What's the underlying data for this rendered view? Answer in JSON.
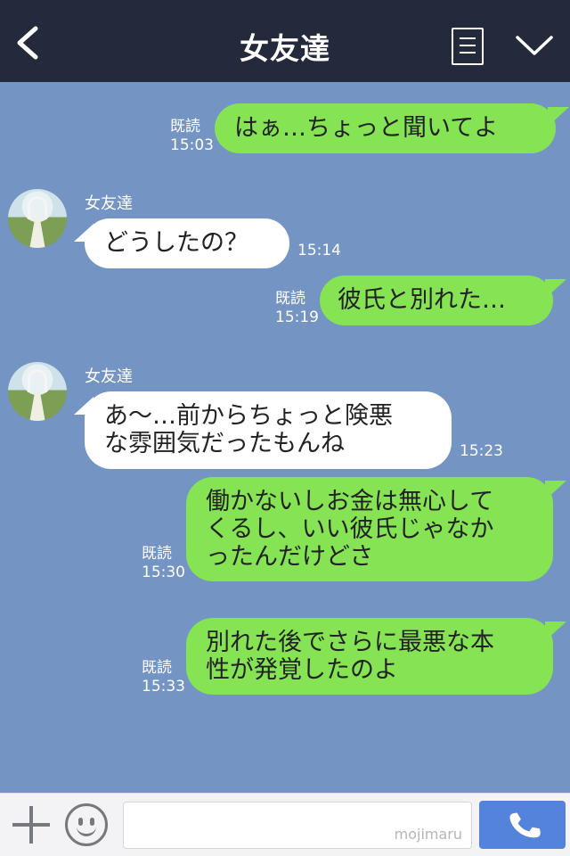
{
  "header": {
    "title": "女友達"
  },
  "messages": [
    {
      "side": "right",
      "text": "はぁ…ちょっと聞いてよ",
      "read": "既読",
      "time": "15:03"
    },
    {
      "side": "left",
      "sender": "女友達",
      "text": "どうしたの？",
      "time": "15:14"
    },
    {
      "side": "right",
      "text": "彼氏と別れた…",
      "read": "既読",
      "time": "15:19"
    },
    {
      "side": "left",
      "sender": "女友達",
      "lines": [
        "あ〜…前からちょっと険悪",
        "な雰囲気だったもんね"
      ],
      "time": "15:23"
    },
    {
      "side": "right",
      "lines": [
        "働かないしお金は無心して",
        "くるし、いい彼氏じゃなか",
        "ったんだけどさ"
      ],
      "read": "既読",
      "time": "15:30"
    },
    {
      "side": "right",
      "lines": [
        "別れた後でさらに最悪な本",
        "性が発覚したのよ"
      ],
      "read": "既読",
      "time": "15:33"
    }
  ],
  "input": {
    "watermark": "mojimaru"
  },
  "icons": {
    "back": "back-arrow-icon",
    "memo": "notes-icon",
    "menu": "chevron-down-icon",
    "add": "plus-icon",
    "emoji": "smiley-icon",
    "call": "phone-icon"
  },
  "colors": {
    "header_bg": "#232a3b",
    "chat_bg": "#7494c3",
    "own_bubble": "#86e354",
    "other_bubble": "#ffffff",
    "call_button": "#5483dc"
  }
}
